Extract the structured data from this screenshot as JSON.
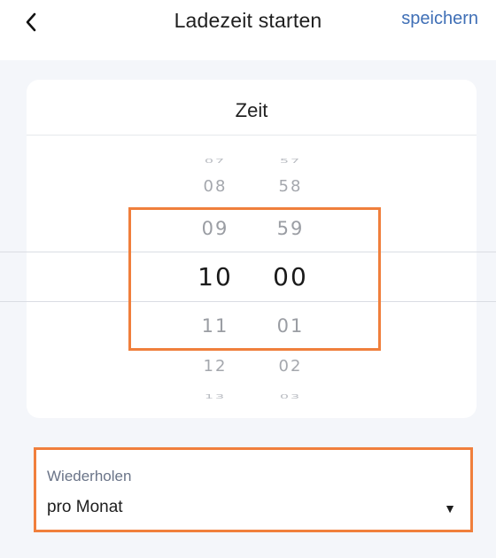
{
  "header": {
    "title": "Ladezeit starten",
    "save_label": "speichern",
    "back_icon": "chevron-left-icon"
  },
  "picker": {
    "title": "Zeit",
    "hours": [
      "07",
      "08",
      "09",
      "10",
      "11",
      "12",
      "13"
    ],
    "minutes": [
      "57",
      "58",
      "59",
      "00",
      "01",
      "02",
      "03"
    ],
    "selected_hour": "10",
    "selected_minute": "00"
  },
  "repeat": {
    "label": "Wiederholen",
    "value": "pro Monat",
    "caret_icon": "triangle-down-icon"
  },
  "colors": {
    "accent_link": "#3f6fb6",
    "highlight": "#f07f3c",
    "background": "#f4f6fa"
  }
}
